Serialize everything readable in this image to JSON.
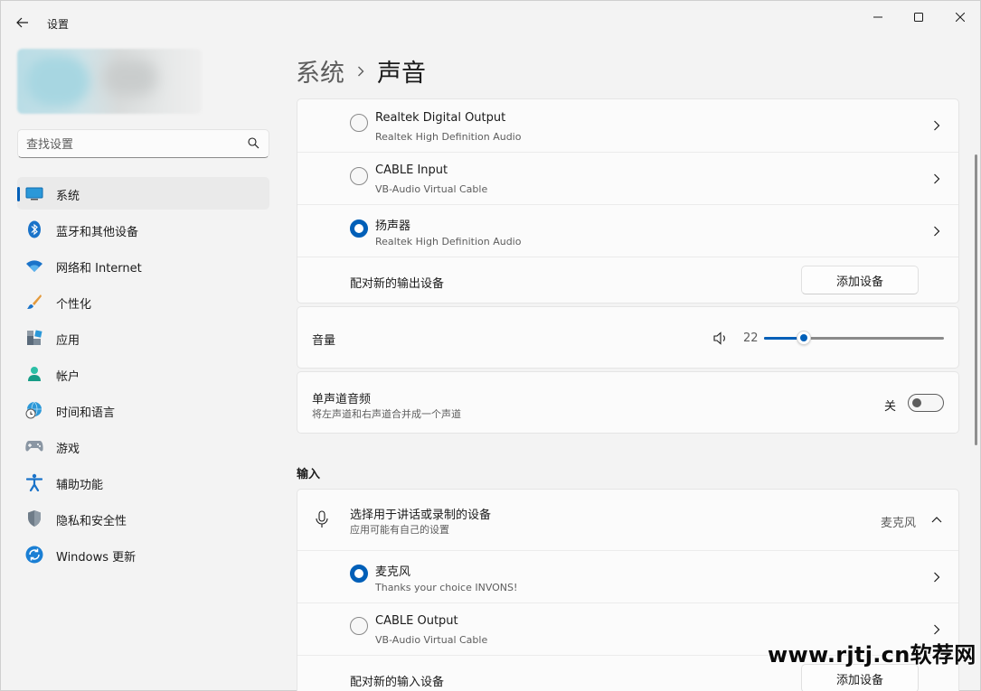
{
  "window": {
    "title": "设置",
    "colors": {
      "accent": "#005fb8",
      "background": "#f3f3f3",
      "card": "#fbfbfb"
    }
  },
  "sidebar": {
    "search_placeholder": "查找设置",
    "items": [
      {
        "label": "系统",
        "icon": "system-icon",
        "selected": true
      },
      {
        "label": "蓝牙和其他设备",
        "icon": "bluetooth-icon"
      },
      {
        "label": "网络和 Internet",
        "icon": "wifi-icon"
      },
      {
        "label": "个性化",
        "icon": "brush-icon"
      },
      {
        "label": "应用",
        "icon": "apps-icon"
      },
      {
        "label": "帐户",
        "icon": "account-icon"
      },
      {
        "label": "时间和语言",
        "icon": "globe-clock-icon"
      },
      {
        "label": "游戏",
        "icon": "gamepad-icon"
      },
      {
        "label": "辅助功能",
        "icon": "accessibility-icon"
      },
      {
        "label": "隐私和安全性",
        "icon": "shield-icon"
      },
      {
        "label": "Windows 更新",
        "icon": "update-icon"
      }
    ]
  },
  "header": {
    "crumb_parent": "系统",
    "crumb_current": "声音"
  },
  "output": {
    "devices": [
      {
        "name": "Realtek Digital Output",
        "sub": "Realtek High Definition Audio",
        "selected": false
      },
      {
        "name": "CABLE Input",
        "sub": "VB-Audio Virtual Cable",
        "selected": false
      },
      {
        "name": "扬声器",
        "sub": "Realtek High Definition Audio",
        "selected": true
      }
    ],
    "pair_label": "配对新的输出设备",
    "add_button": "添加设备"
  },
  "volume": {
    "label": "音量",
    "value": "22",
    "level": 22
  },
  "mono": {
    "label": "单声道音频",
    "desc": "将左声道和右声道合并成一个声道",
    "state_label": "关",
    "on": false
  },
  "input": {
    "section_title": "输入",
    "header_title": "选择用于讲话或录制的设备",
    "header_sub": "应用可能有自己的设置",
    "current": "麦克风",
    "devices": [
      {
        "name": "麦克风",
        "sub": "Thanks your choice INVONS!",
        "selected": true
      },
      {
        "name": "CABLE Output",
        "sub": "VB-Audio Virtual Cable",
        "selected": false
      }
    ],
    "pair_label": "配对新的输入设备",
    "add_button": "添加设备"
  },
  "watermark": "www.rjtj.cn软荐网"
}
